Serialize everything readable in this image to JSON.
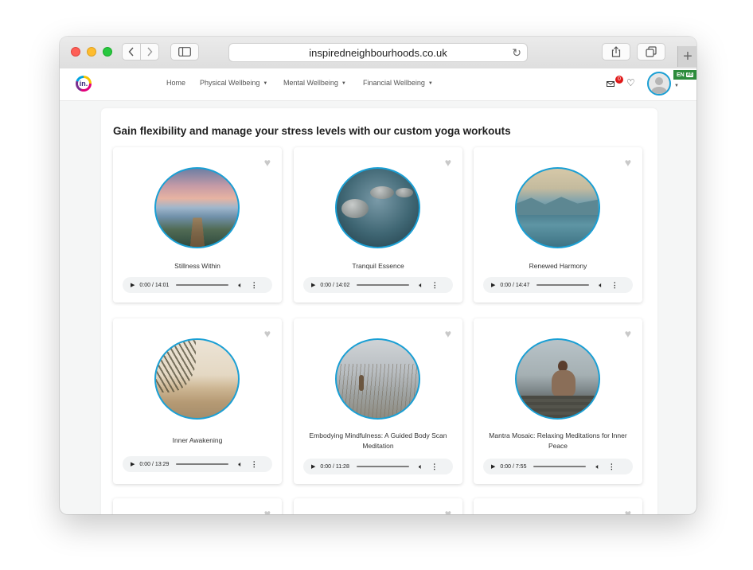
{
  "browser": {
    "url": "inspiredneighbourhoods.co.uk",
    "new_tab_label": "+"
  },
  "site": {
    "logo_text": "in.",
    "nav": [
      {
        "label": "Home",
        "has_dropdown": false
      },
      {
        "label": "Physical Wellbeing",
        "has_dropdown": true
      },
      {
        "label": "Mental Wellbeing",
        "has_dropdown": true
      },
      {
        "label": "Financial Wellbeing",
        "has_dropdown": true
      }
    ],
    "notification_count": "0",
    "language": "EN",
    "language_icon": "AB"
  },
  "page": {
    "title": "Gain flexibility and manage your stress levels with our custom yoga workouts"
  },
  "cards": [
    {
      "title": "Stillness Within",
      "time": "0:00 / 14:01",
      "image": "lake-pier-sunset"
    },
    {
      "title": "Tranquil Essence",
      "time": "0:00 / 14:02",
      "image": "zen-stones-water"
    },
    {
      "title": "Renewed Harmony",
      "time": "0:00 / 14:47",
      "image": "misty-mountain-lake"
    },
    {
      "title": "Inner Awakening",
      "time": "0:00 / 13:29",
      "image": "palm-beach-sunset"
    },
    {
      "title": "Embodying Mindfulness: A Guided Body Scan Meditation",
      "time": "0:00 / 11:28",
      "image": "frosty-grass"
    },
    {
      "title": "Mantra Mosaic: Relaxing Meditations for Inner Peace",
      "time": "0:00 / 7:55",
      "image": "woman-meditating-dock"
    }
  ],
  "colors": {
    "accent": "#1a9fd4",
    "badge": "#e01818",
    "language_bg": "#2d8c3c"
  }
}
